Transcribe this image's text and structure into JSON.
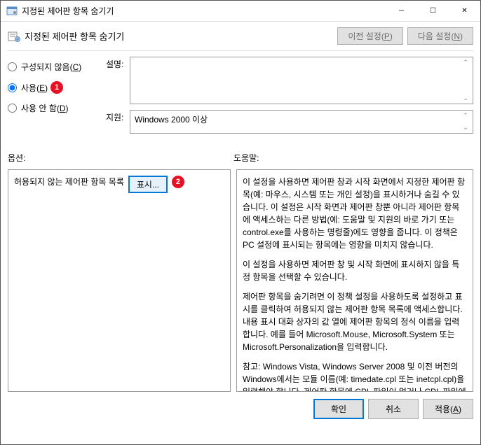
{
  "window": {
    "title": "지정된 제어판 항목 숨기기",
    "min": "─",
    "max": "☐",
    "close": "✕"
  },
  "header": {
    "title": "지정된 제어판 항목 숨기기",
    "prev": "이전 설정",
    "prev_key": "P",
    "next": "다음 설정",
    "next_key": "N"
  },
  "radios": {
    "not_configured": "구성되지 않음",
    "not_configured_key": "C",
    "enabled": "사용",
    "enabled_key": "E",
    "disabled": "사용 안 함",
    "disabled_key": "D"
  },
  "markers": {
    "one": "1",
    "two": "2"
  },
  "labels": {
    "description": "설명:",
    "supported": "지원:",
    "options": "옵션:",
    "help": "도움말:"
  },
  "supported_text": "Windows 2000 이상",
  "options": {
    "list_label": "허용되지 않는 제어판 항목 목록",
    "show_button": "표시..."
  },
  "help": {
    "p1": "이 설정을 사용하면 제어판 창과 시작 화면에서 지정한 제어판 항목(예: 마우스, 시스템 또는 개인 설정)을 표시하거나 숨길 수 있습니다. 이 설정은 시작 화면과 제어판 창뿐 아니라 제어판 항목에 액세스하는 다른 방법(예: 도움말 및 지원의 바로 가기 또는 control.exe를 사용하는 명령줄)에도 영향을 줍니다. 이 정책은 PC 설정에 표시되는 항목에는 영향을 미치지 않습니다.",
    "p2": "이 설정을 사용하면 제어판 창 및 시작 화면에 표시하지 않을 특정 항목을 선택할 수 있습니다.",
    "p3": "제어판 항목을 숨기려면 이 정책 설정을 사용하도록 설정하고 표시를 클릭하여 허용되지 않는 제어판 항목 목록에 액세스합니다. 내용 표시 대화 상자의 값 열에 제어판 항목의 정식 이름을 입력합니다. 예를 들어 Microsoft.Mouse, Microsoft.System 또는 Microsoft.Personalization을 입력합니다.",
    "p4": "참고: Windows Vista, Windows Server 2008 및 이전 버전의 Windows에서는 모듈 이름(예: timedate.cpl 또는 inetcpl.cpl)을 입력해야 합니다. 제어판 항목에 CPL 파일이 없거나 CPL 파일에 여러 개의 애플릿이 포함되어 있으면 해당 모듈 이름과 문자열 리소스 식별 번호를 입력해야 합니다. 예를 들어 시스템의 경우"
  },
  "footer": {
    "ok": "확인",
    "cancel": "취소",
    "apply": "적용",
    "apply_key": "A"
  }
}
